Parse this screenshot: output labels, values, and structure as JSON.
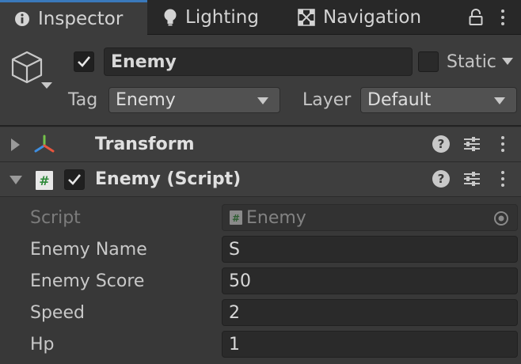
{
  "tabs": [
    {
      "label": "Inspector",
      "icon": "info-icon",
      "active": true
    },
    {
      "label": "Lighting",
      "icon": "lightbulb-icon",
      "active": false
    },
    {
      "label": "Navigation",
      "icon": "navigation-icon",
      "active": false
    }
  ],
  "header": {
    "object_name": "Enemy",
    "active": true,
    "static_label": "Static",
    "static_checked": false,
    "tag_label": "Tag",
    "tag_value": "Enemy",
    "layer_label": "Layer",
    "layer_value": "Default"
  },
  "components": {
    "transform": {
      "title": "Transform",
      "expanded": false
    },
    "script": {
      "title": "Enemy (Script)",
      "enabled": true,
      "expanded": true,
      "properties": [
        {
          "label": "Script",
          "value": "Enemy",
          "disabled": true
        },
        {
          "label": "Enemy Name",
          "value": "S"
        },
        {
          "label": "Enemy Score",
          "value": "50"
        },
        {
          "label": "Speed",
          "value": "2"
        },
        {
          "label": "Hp",
          "value": "1"
        }
      ]
    }
  },
  "colors": {
    "background": "#383838",
    "tab_bar": "#282828",
    "active_tab_accent": "#3a79bb",
    "field_bg": "#2a2a2a",
    "dropdown_bg": "#515151"
  }
}
